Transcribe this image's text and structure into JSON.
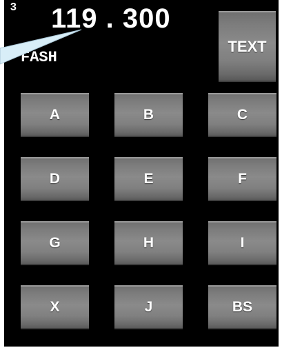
{
  "display": {
    "index": "3",
    "frequency": "119.300",
    "ident": "FASH"
  },
  "keys": {
    "text": "TEXT",
    "grid": [
      "A",
      "B",
      "C",
      "D",
      "E",
      "F",
      "G",
      "H",
      "I",
      "X",
      "J",
      "BS"
    ]
  },
  "colors": {
    "background": "#000000",
    "key_face": "#808080",
    "pointer": "#d8eef8",
    "text": "#ffffff"
  }
}
